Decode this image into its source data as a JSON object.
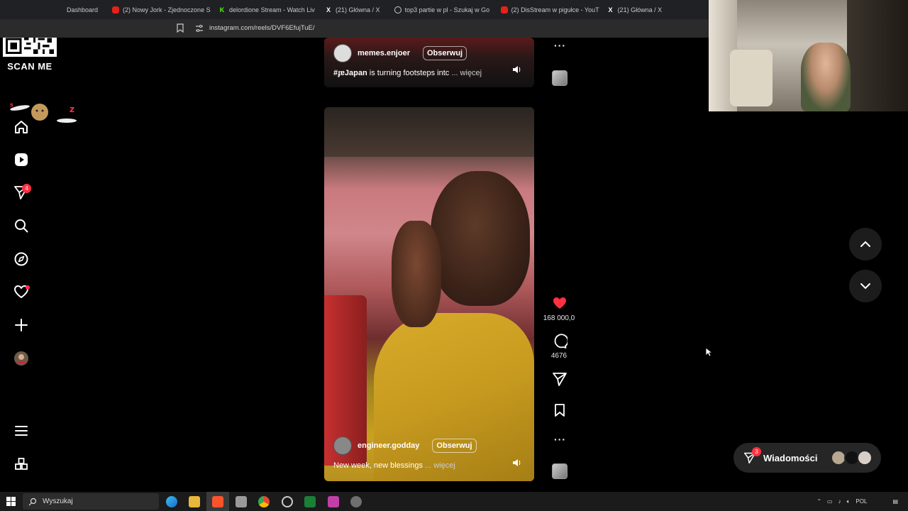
{
  "qr": {
    "label": "SCAN ME"
  },
  "tabs": [
    {
      "title": "Dashboard",
      "icon": "none"
    },
    {
      "title": "(2) Nowy Jork - Zjednoczone S",
      "icon": "youtube-icon"
    },
    {
      "title": "delordione Stream - Watch Liv",
      "icon": "kick-icon"
    },
    {
      "title": "(21) Główna / X",
      "icon": "x-icon"
    },
    {
      "title": "top3 partie w pl - Szukaj w Go",
      "icon": "google-icon"
    },
    {
      "title": "(2) DisStream w pigułce - YouT",
      "icon": "youtube-icon"
    },
    {
      "title": "(21) Główna / X",
      "icon": "x-icon"
    }
  ],
  "address": {
    "url": "instagram.com/reels/DVF6EfujTuE/"
  },
  "nav": {
    "notifications_badge": "4"
  },
  "reels": [
    {
      "username": "memes.enjoer",
      "follow_label": "Obserwuj",
      "caption_tag": "#ɟɐJapan",
      "caption_text": " is turning footsteps intc",
      "more_label": "... więcej"
    },
    {
      "username": "engineer.godday",
      "follow_label": "Obserwuj",
      "caption_text": "New week, new blessings",
      "more_label": " ... więcej"
    }
  ],
  "actions": {
    "likes": "168 000,0",
    "comments": "4676"
  },
  "messages": {
    "label": "Wiadomości",
    "badge": "3"
  },
  "taskbar": {
    "search_placeholder": "Wyszukaj",
    "language": "POL"
  },
  "colors": {
    "accent_red": "#ff3040",
    "like_red": "#ff3040",
    "background": "#000000"
  }
}
